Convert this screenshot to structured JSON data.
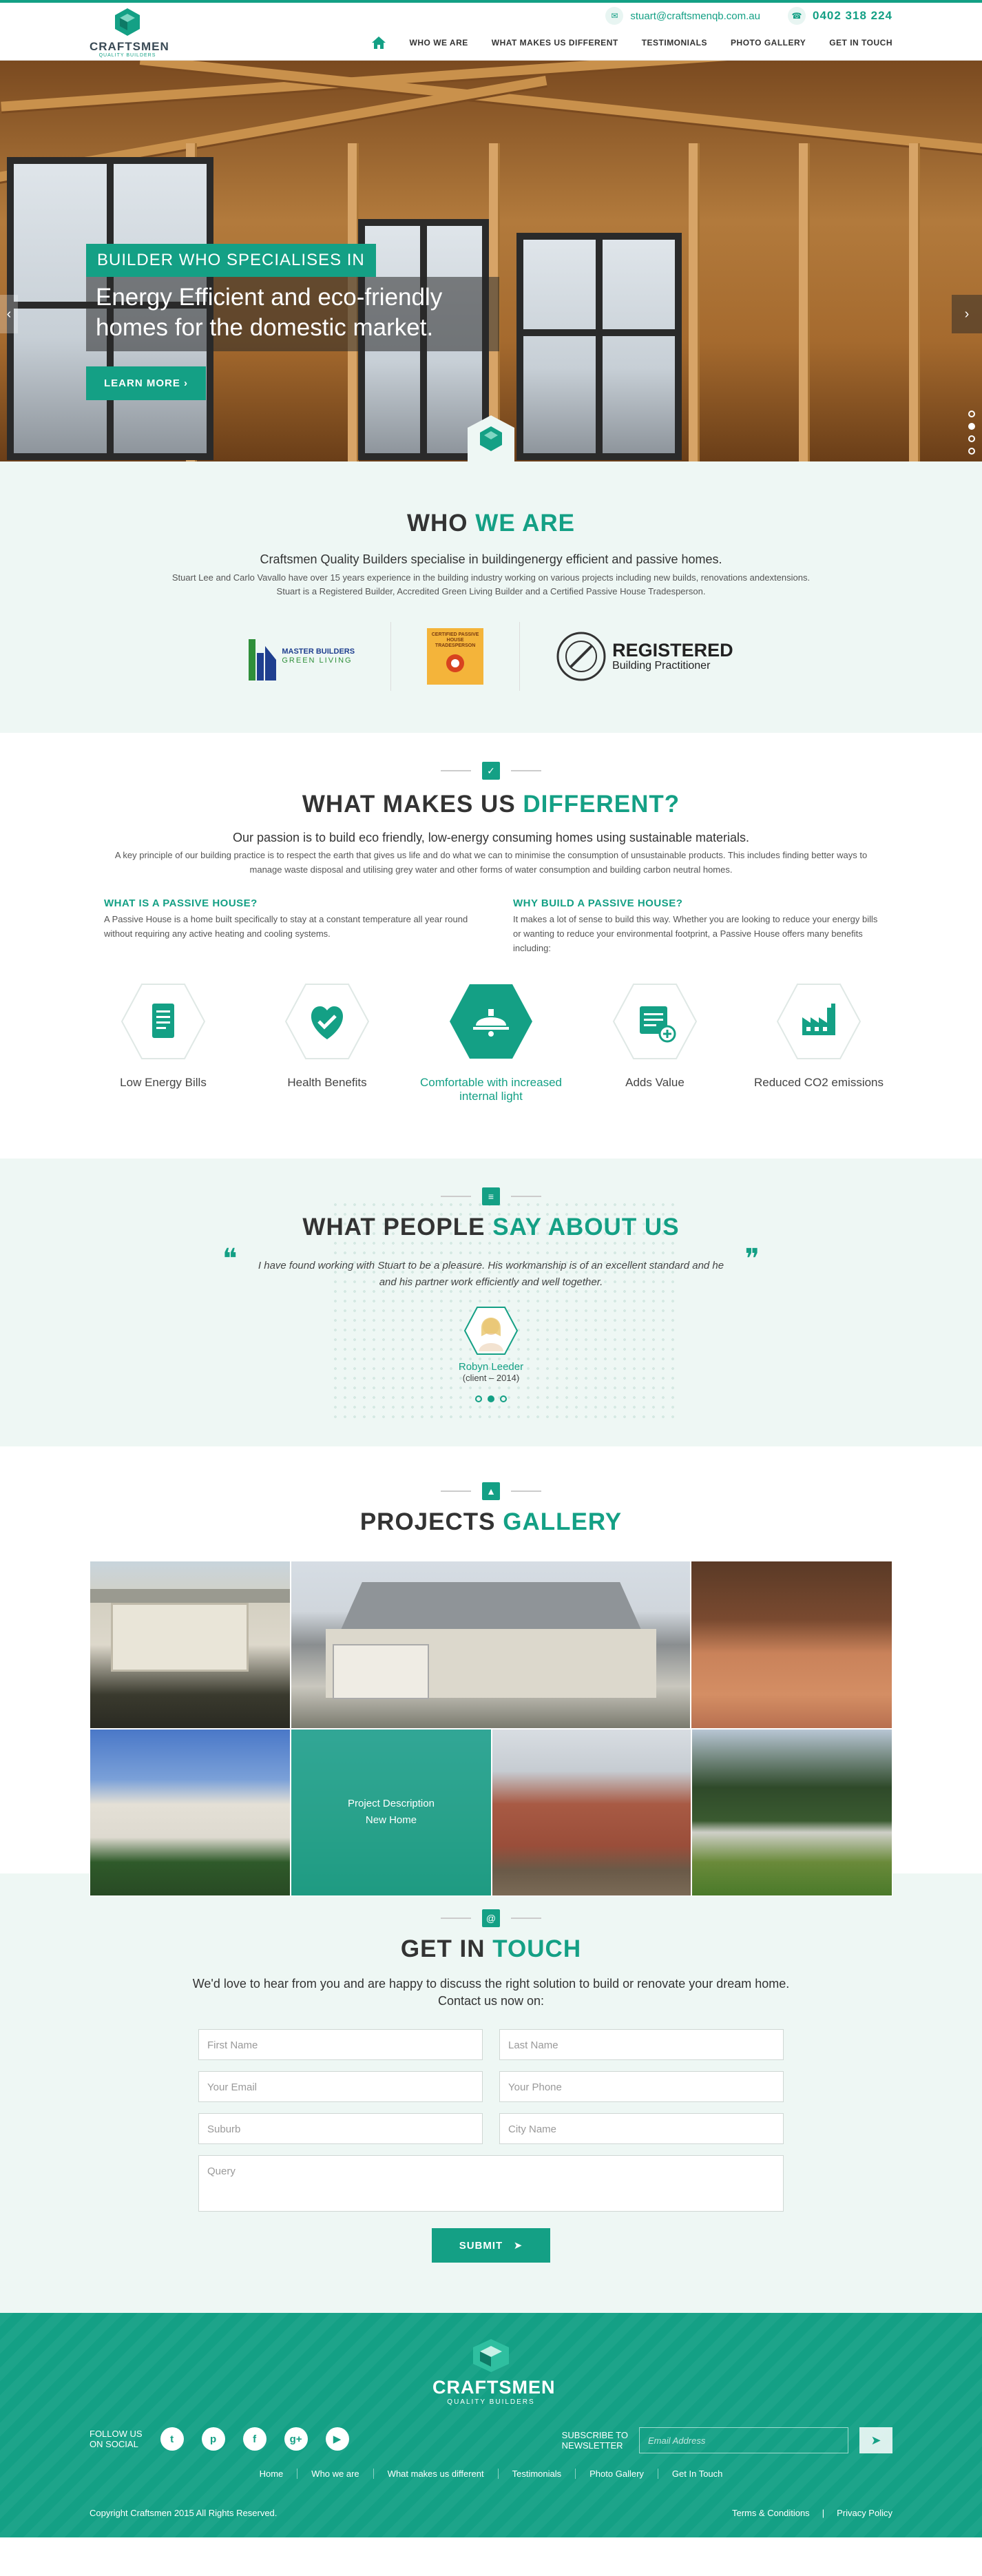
{
  "header": {
    "logo_name": "CRAFTSMEN",
    "logo_sub": "QUALITY BUILDERS",
    "email": "stuart@craftsmenqb.com.au",
    "phone": "0402 318 224",
    "nav": [
      "WHO WE ARE",
      "WHAT MAKES US DIFFERENT",
      "TESTIMONIALS",
      "PHOTO GALLERY",
      "GET IN TOUCH"
    ]
  },
  "hero": {
    "banner": "BUILDER WHO SPECIALISES IN",
    "headline": "Energy Efficient and eco-friendly homes for the domestic market.",
    "cta": "LEARN MORE",
    "slide_count": 4,
    "active_slide": 2
  },
  "who": {
    "title_a": "WHO",
    "title_b": "WE ARE",
    "lead": "Craftsmen Quality Builders specialise in buildingenergy efficient and passive homes.",
    "p1": "Stuart Lee and Carlo Vavallo have over 15 years experience in the building industry working on various projects including new builds, renovations andextensions.",
    "p2": "Stuart is a Registered Builder, Accredited Green Living Builder and a Certified Passive House Tradesperson.",
    "cert1_a": "MASTER BUILDERS",
    "cert1_b": "GREEN LIVING",
    "cert2": "CERTIFIED PASSIVE HOUSE TRADESPERSON",
    "cert3_a": "REGISTERED",
    "cert3_b": "Building Practitioner"
  },
  "diff": {
    "title_a": "WHAT MAKES US",
    "title_b": "DIFFERENT?",
    "lead": "Our passion is to build eco friendly, low-energy consuming homes using sustainable materials.",
    "p": "A key principle of our building practice is to respect the earth that gives us life and do what we can to minimise the consumption of unsustainable products. This includes finding better ways to manage waste disposal and utilising grey water and other forms of water consumption and building carbon neutral homes.",
    "col1_h": "WHAT IS A PASSIVE HOUSE?",
    "col1_p": "A Passive House is a home built specifically to stay at a constant temperature all year round without requiring any active heating and cooling systems.",
    "col2_h": "WHY BUILD A PASSIVE HOUSE?",
    "col2_p": "It makes a lot of sense to build this way.  Whether you are looking to reduce your energy bills or wanting to reduce your environmental footprint, a Passive House offers many benefits including:",
    "features": [
      {
        "label": "Low Energy Bills",
        "icon": "bill-icon"
      },
      {
        "label": "Health Benefits",
        "icon": "heart-check-icon"
      },
      {
        "label": "Comfortable with increased internal light",
        "icon": "lamp-icon"
      },
      {
        "label": "Adds Value",
        "icon": "value-add-icon"
      },
      {
        "label": "Reduced CO2 emissions",
        "icon": "factory-icon"
      }
    ]
  },
  "testimonials": {
    "title_a": "WHAT PEOPLE",
    "title_b": "SAY ABOUT US",
    "quote": "I have found working with Stuart to be a pleasure.  His workmanship is of an excellent standard and he and his partner work efficiently and well together.",
    "name": "Robyn Leeder",
    "year": "(client – 2014)",
    "slide_count": 3,
    "active_slide": 2
  },
  "gallery": {
    "title_a": "PROJECTS",
    "title_b": "GALLERY",
    "overlay_title": "Project Description",
    "overlay_sub": "New Home"
  },
  "touch": {
    "title_a": "GET IN",
    "title_b": "TOUCH",
    "lead1": "We'd love to hear from you and are happy to discuss the right solution to build or renovate your dream home.",
    "lead2": "Contact us now on:",
    "first_name": "First Name",
    "last_name": "Last Name",
    "email": "Your Email",
    "phone": "Your Phone",
    "suburb": "Suburb",
    "city": "City Name",
    "query": "Query",
    "submit": "SUBMIT"
  },
  "footer": {
    "logo_name": "CRAFTSMEN",
    "logo_sub": "QUALITY BUILDERS",
    "follow_a": "FOLLOW US",
    "follow_b": "ON SOCIAL",
    "subscribe_a": "SUBSCRIBE TO",
    "subscribe_b": "NEWSLETTER",
    "newsletter_placeholder": "Email Address",
    "links": [
      "Home",
      "Who we are",
      "What makes us different",
      "Testimonials",
      "Photo Gallery",
      "Get In Touch"
    ],
    "copyright": "Copyright Craftsmen 2015 All Rights Reserved.",
    "terms": "Terms & Conditions",
    "privacy": "Privacy Policy"
  },
  "colors": {
    "accent": "#14a085",
    "light_bg": "#eef7f4"
  }
}
